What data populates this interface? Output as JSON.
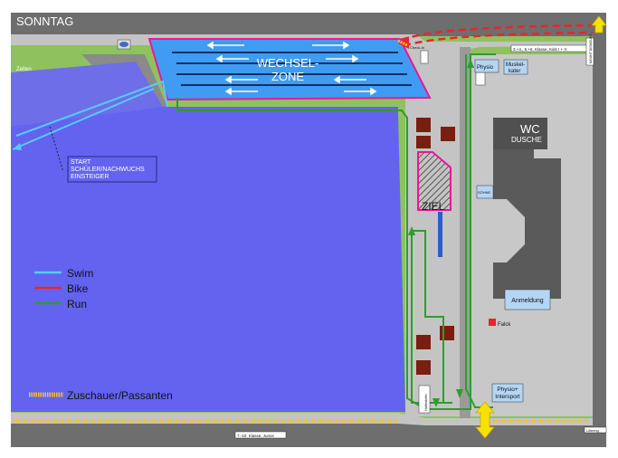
{
  "title": "SONNTAG",
  "labels": {
    "zelten": "Zelten",
    "wechselzone_1": "WECHSEL-",
    "wechselzone_2": "ZONE",
    "start_1": "START",
    "start_2": "SCHÜLER/NACHWUCHS",
    "start_3": "EINSTEIGER",
    "wc": "WC",
    "dusche": "DUSCHE",
    "ziel": "ZIEL",
    "physio": "Physio",
    "muskelkater_1": "Muskel-",
    "muskelkater_2": "kater",
    "anmeldung": "Anmeldung",
    "falck": "Falck",
    "physio_intersport_1": "Physio+",
    "physio_intersport_2": "Intersport",
    "check_in": "Check-In",
    "sohne": "SÖHNE",
    "klassen_top": "3.+4., 5.+6. Klasse, Kids I + II",
    "mount": "MOUNT DISMOUNT",
    "klassen_bottom": "7.-10. Klasse, Junior",
    "lillering": "Lillering",
    "haltestelle": "Haltestelle"
  },
  "legend": [
    {
      "label": "Swim",
      "color": "#55ccff"
    },
    {
      "label": "Bike",
      "color": "#e8262b"
    },
    {
      "label": "Run",
      "color": "#2e9d2e"
    }
  ],
  "spectators": {
    "label": "Zuschauer/Passanten",
    "color": "#f0c030"
  },
  "colors": {
    "lake": "#6363f0",
    "transition": "#3f9cf2",
    "road": "#6e6e6e",
    "path": "#c4c4c4",
    "grass": "#8fc25e",
    "building": "#5a5a5a",
    "booth": "#7a1e12",
    "finish": "#e8189a"
  }
}
